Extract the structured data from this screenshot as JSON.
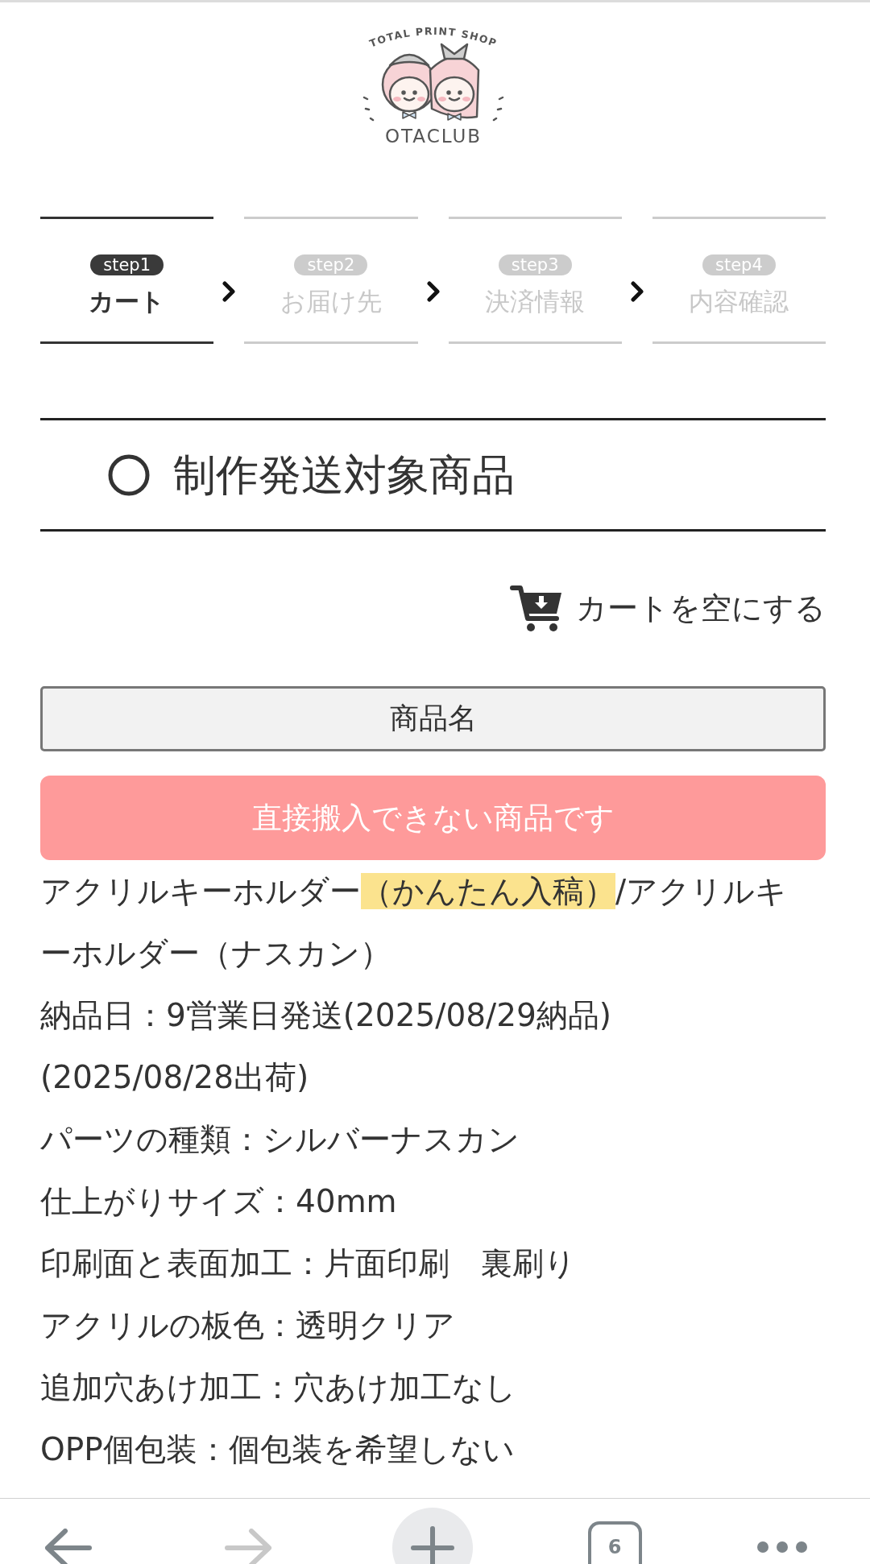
{
  "logo": {
    "tagline": "TOTAL PRINT SHOP",
    "name": "OTACLUB"
  },
  "steps": [
    {
      "badge": "step1",
      "label": "カート",
      "selected": true
    },
    {
      "badge": "step2",
      "label": "お届け先",
      "selected": false
    },
    {
      "badge": "step3",
      "label": "決済情報",
      "selected": false
    },
    {
      "badge": "step4",
      "label": "内容確認",
      "selected": false
    }
  ],
  "section": {
    "title": "制作発送対象商品"
  },
  "empty_cart": {
    "label": "カートを空にする"
  },
  "table": {
    "columns": [
      "商品名"
    ]
  },
  "notice": "直接搬入できない商品です",
  "product": {
    "name_parts": [
      {
        "text": "アクリルキーホルダー",
        "highlighted": false
      },
      {
        "text": "（かんたん入稿）",
        "highlighted": true
      },
      {
        "text": "/アクリルキーホルダー（ナスカン）",
        "highlighted": false
      }
    ],
    "details": [
      "納品日：9営業日発送(2025/08/29納品)",
      "(2025/08/28出荷)",
      "パーツの種類：シルバーナスカン",
      "仕上がりサイズ：40mm",
      "印刷面と表面加工：片面印刷　裏刷り",
      "アクリルの板色：透明クリア",
      "追加穴あけ加工：穴あけ加工なし",
      "OPP個包装：個包装を希望しない"
    ]
  },
  "browser_toolbar": {
    "forward_disabled": true,
    "tab_count": "6"
  }
}
